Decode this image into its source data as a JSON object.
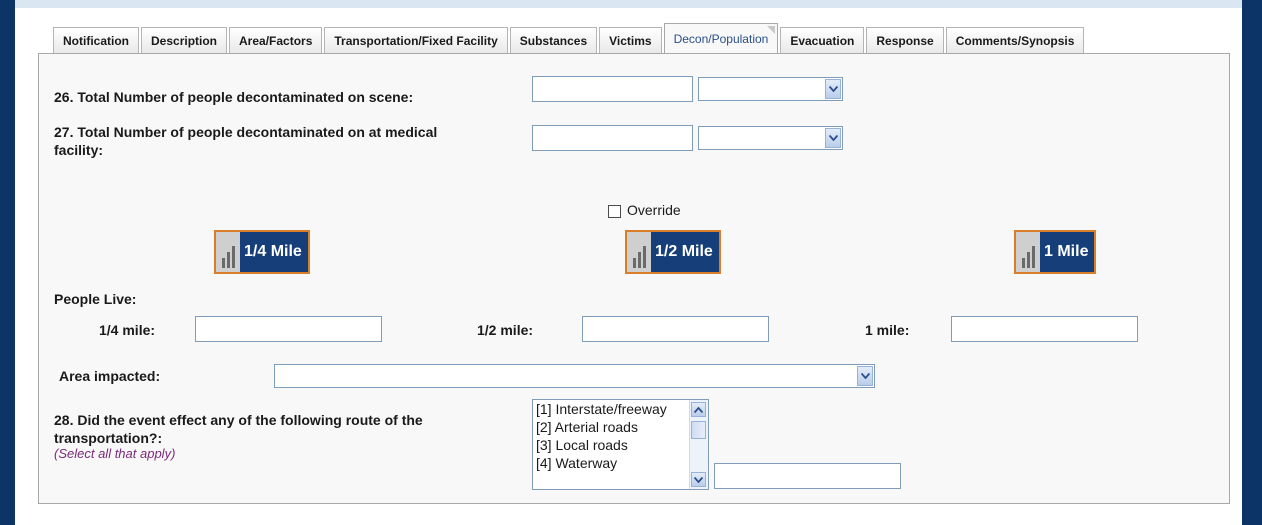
{
  "tabs": [
    {
      "label": "Notification"
    },
    {
      "label": "Description"
    },
    {
      "label": "Area/Factors"
    },
    {
      "label": "Transportation/Fixed Facility"
    },
    {
      "label": "Substances"
    },
    {
      "label": "Victims"
    },
    {
      "label": "Decon/Population",
      "active": true
    },
    {
      "label": "Evacuation"
    },
    {
      "label": "Response"
    },
    {
      "label": "Comments/Synopsis"
    }
  ],
  "q26": {
    "label": "26. Total Number of people decontaminated on scene:",
    "value": "",
    "unit": ""
  },
  "q27": {
    "label_line1": "27. Total Number of people decontaminated on at medical",
    "label_line2": "facility:",
    "value": "",
    "unit": ""
  },
  "override": {
    "label": "Override",
    "checked": false
  },
  "mile_buttons": {
    "quarter": "1/4 Mile",
    "half": "1/2 Mile",
    "one": "1 Mile"
  },
  "people_live": {
    "label": "People Live:",
    "quarter_label": "1/4 mile:",
    "quarter_value": "",
    "half_label": "1/2 mile:",
    "half_value": "",
    "one_label": "1 mile:",
    "one_value": ""
  },
  "area_impacted": {
    "label": "Area impacted:",
    "value": ""
  },
  "q28": {
    "label_line1": "28. Did the event effect any of the following route of the",
    "label_line2": "transportation?:",
    "hint": "(Select all that apply)",
    "options": [
      "[1] Interstate/freeway",
      "[2] Arterial roads",
      "[3] Local roads",
      "[4] Waterway"
    ],
    "other_value": ""
  },
  "colors": {
    "navy": "#0d3466",
    "button_blue": "#163f7a",
    "button_border": "#d97f2a",
    "hint_purple": "#7a2a7a"
  }
}
